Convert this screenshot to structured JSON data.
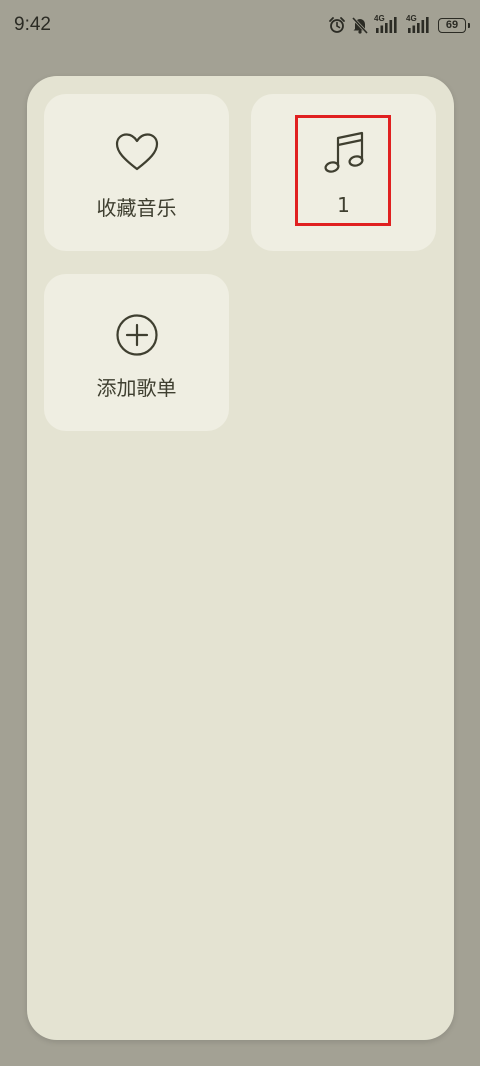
{
  "status_bar": {
    "time": "9:42",
    "network_1": "4G",
    "network_2": "4G",
    "battery": "69",
    "icons": [
      "alarm-icon",
      "mute-icon",
      "signal-icon",
      "signal-icon",
      "battery-icon"
    ]
  },
  "tiles": {
    "favorites_label": "收藏音乐",
    "playlist_label": "1",
    "add_label": "添加歌单"
  },
  "colors": {
    "background": "#a3a194",
    "panel": "#e4e3d2",
    "tile": "#efeee2",
    "text": "#3f3f30",
    "highlight": "#e02020"
  }
}
